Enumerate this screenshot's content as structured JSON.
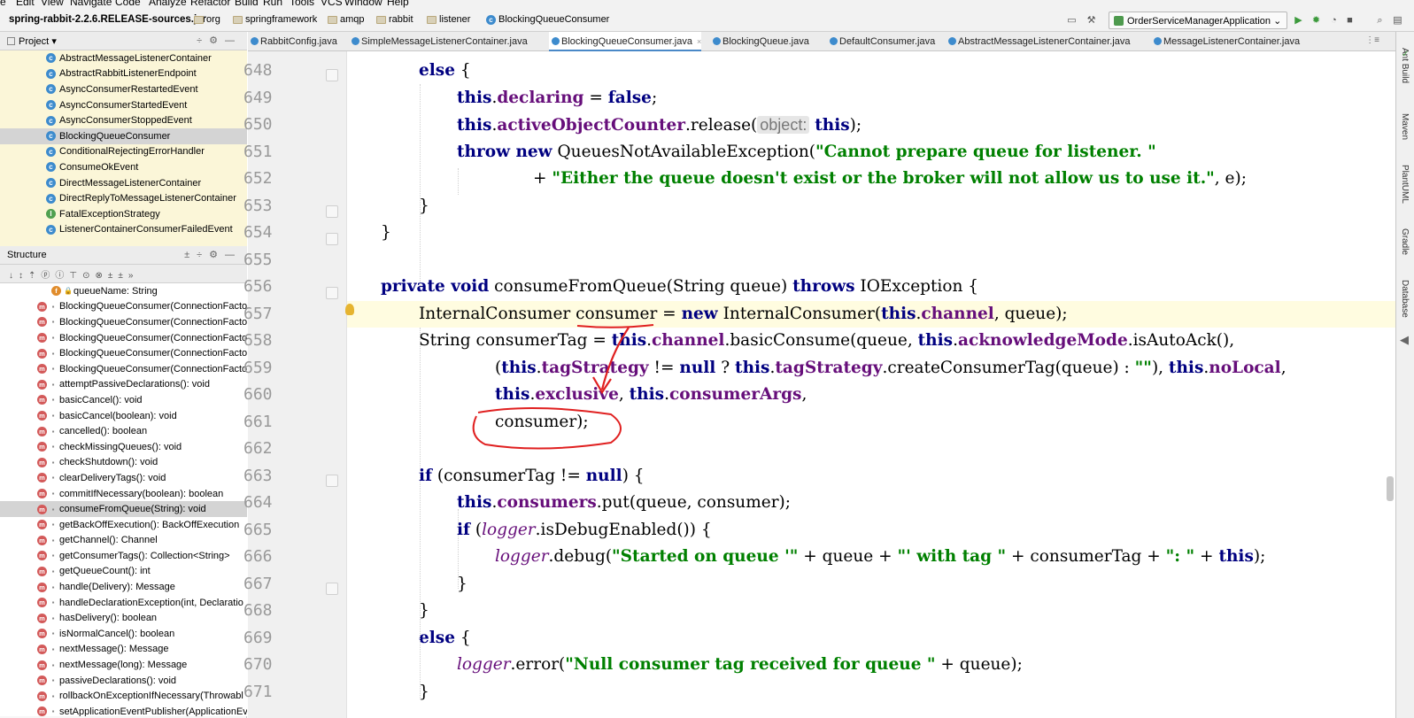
{
  "menu": [
    "e",
    "Edit",
    "View",
    "Navigate",
    "Code",
    "Analyze",
    "Refactor",
    "Build",
    "Run",
    "Tools",
    "VCS",
    "Window",
    "Help"
  ],
  "breadcrumbs": [
    "spring-rabbit-2.2.6.RELEASE-sources.jar",
    "org",
    "springframework",
    "amqp",
    "rabbit",
    "listener",
    "BlockingQueueConsumer"
  ],
  "run_config": "OrderServiceManagerApplication",
  "project_panel": {
    "title": "Project",
    "items": [
      "AbstractMessageListenerContainer",
      "AbstractRabbitListenerEndpoint",
      "AsyncConsumerRestartedEvent",
      "AsyncConsumerStartedEvent",
      "AsyncConsumerStoppedEvent",
      "BlockingQueueConsumer",
      "ConditionalRejectingErrorHandler",
      "ConsumeOkEvent",
      "DirectMessageListenerContainer",
      "DirectReplyToMessageListenerContainer",
      "FatalExceptionStrategy",
      "ListenerContainerConsumerFailedEvent"
    ],
    "selected_index": 5
  },
  "structure_panel": {
    "title": "Structure",
    "field": "queueName: String",
    "items": [
      "BlockingQueueConsumer(ConnectionFacto",
      "BlockingQueueConsumer(ConnectionFacto",
      "BlockingQueueConsumer(ConnectionFacto",
      "BlockingQueueConsumer(ConnectionFacto",
      "BlockingQueueConsumer(ConnectionFacto",
      "attemptPassiveDeclarations(): void",
      "basicCancel(): void",
      "basicCancel(boolean): void",
      "cancelled(): boolean",
      "checkMissingQueues(): void",
      "checkShutdown(): void",
      "clearDeliveryTags(): void",
      "commitIfNecessary(boolean): boolean",
      "consumeFromQueue(String): void",
      "getBackOffExecution(): BackOffExecution",
      "getChannel(): Channel",
      "getConsumerTags(): Collection<String>",
      "getQueueCount(): int",
      "handle(Delivery): Message",
      "handleDeclarationException(int, Declaratio",
      "hasDelivery(): boolean",
      "isNormalCancel(): boolean",
      "nextMessage(): Message",
      "nextMessage(long): Message",
      "passiveDeclarations(): void",
      "rollbackOnExceptionIfNecessary(Throwabl",
      "setApplicationEventPublisher(ApplicationEv"
    ],
    "selected_index": 13
  },
  "tabs": [
    {
      "label": "RabbitConfig.java"
    },
    {
      "label": "SimpleMessageListenerContainer.java"
    },
    {
      "label": "BlockingQueueConsumer.java",
      "active": true
    },
    {
      "label": "BlockingQueue.java"
    },
    {
      "label": "DefaultConsumer.java"
    },
    {
      "label": "AbstractMessageListenerContainer.java"
    },
    {
      "label": "MessageListenerContainer.java"
    }
  ],
  "right_tools": [
    "Ant Build",
    "Maven",
    "PlantUML",
    "Gradle",
    "Database"
  ],
  "editor": {
    "current_line": 657,
    "lines": [
      {
        "n": 648,
        "indent": 1,
        "tokens": [
          [
            "kw",
            "else"
          ],
          [
            "p",
            " {"
          ]
        ]
      },
      {
        "n": 649,
        "indent": 2,
        "tokens": [
          [
            "kw",
            "this"
          ],
          [
            "p",
            "."
          ],
          [
            "fld",
            "declaring"
          ],
          [
            "p",
            " = "
          ],
          [
            "kw",
            "false"
          ],
          [
            "p",
            ";"
          ]
        ]
      },
      {
        "n": 650,
        "indent": 2,
        "tokens": [
          [
            "kw",
            "this"
          ],
          [
            "p",
            "."
          ],
          [
            "fld",
            "activeObjectCounter"
          ],
          [
            "p",
            ".release("
          ],
          [
            "hint",
            "object:"
          ],
          [
            "p",
            " "
          ],
          [
            "kw",
            "this"
          ],
          [
            "p",
            ");"
          ]
        ]
      },
      {
        "n": 651,
        "indent": 2,
        "tokens": [
          [
            "kw",
            "throw new"
          ],
          [
            "p",
            " QueuesNotAvailableException("
          ],
          [
            "str",
            "\"Cannot prepare queue for listener. \""
          ]
        ]
      },
      {
        "n": 652,
        "indent": 4,
        "tokens": [
          [
            "p",
            "+ "
          ],
          [
            "str",
            "\"Either the queue doesn't exist or the broker will not allow us to use it.\""
          ],
          [
            "p",
            ", e);"
          ]
        ]
      },
      {
        "n": 653,
        "indent": 1,
        "tokens": [
          [
            "p",
            "}"
          ]
        ]
      },
      {
        "n": 654,
        "indent": 0,
        "tokens": [
          [
            "p",
            "}"
          ]
        ]
      },
      {
        "n": 655,
        "indent": 0,
        "tokens": []
      },
      {
        "n": 656,
        "indent": 0,
        "tokens": [
          [
            "kw",
            "private void"
          ],
          [
            "p",
            " consumeFromQueue(String queue) "
          ],
          [
            "kw",
            "throws"
          ],
          [
            "p",
            " IOException {"
          ]
        ]
      },
      {
        "n": 657,
        "indent": 1,
        "tokens": [
          [
            "p",
            "InternalConsumer consumer = "
          ],
          [
            "kw",
            "new"
          ],
          [
            "p",
            " InternalConsumer("
          ],
          [
            "kw",
            "this"
          ],
          [
            "p",
            "."
          ],
          [
            "fld",
            "channel"
          ],
          [
            "p",
            ", queue);"
          ]
        ]
      },
      {
        "n": 658,
        "indent": 1,
        "tokens": [
          [
            "p",
            "String consumerTag = "
          ],
          [
            "kw",
            "this"
          ],
          [
            "p",
            "."
          ],
          [
            "fld",
            "channel"
          ],
          [
            "p",
            ".basicConsume(queue, "
          ],
          [
            "kw",
            "this"
          ],
          [
            "p",
            "."
          ],
          [
            "fld",
            "acknowledgeMode"
          ],
          [
            "p",
            ".isAutoAck(),"
          ]
        ]
      },
      {
        "n": 659,
        "indent": 3,
        "tokens": [
          [
            "p",
            "("
          ],
          [
            "kw",
            "this"
          ],
          [
            "p",
            "."
          ],
          [
            "fld",
            "tagStrategy"
          ],
          [
            "p",
            " != "
          ],
          [
            "kw",
            "null"
          ],
          [
            "p",
            " ? "
          ],
          [
            "kw",
            "this"
          ],
          [
            "p",
            "."
          ],
          [
            "fld",
            "tagStrategy"
          ],
          [
            "p",
            ".createConsumerTag(queue) : "
          ],
          [
            "str",
            "\"\""
          ],
          [
            "p",
            "), "
          ],
          [
            "kw",
            "this"
          ],
          [
            "p",
            "."
          ],
          [
            "fld",
            "noLocal"
          ],
          [
            "p",
            ","
          ]
        ]
      },
      {
        "n": 660,
        "indent": 3,
        "tokens": [
          [
            "kw",
            "this"
          ],
          [
            "p",
            "."
          ],
          [
            "fld",
            "exclusive"
          ],
          [
            "p",
            ", "
          ],
          [
            "kw",
            "this"
          ],
          [
            "p",
            "."
          ],
          [
            "fld",
            "consumerArgs"
          ],
          [
            "p",
            ","
          ]
        ]
      },
      {
        "n": 661,
        "indent": 3,
        "tokens": [
          [
            "p",
            "consumer);"
          ]
        ]
      },
      {
        "n": 662,
        "indent": 0,
        "tokens": []
      },
      {
        "n": 663,
        "indent": 1,
        "tokens": [
          [
            "kw",
            "if"
          ],
          [
            "p",
            " (consumerTag != "
          ],
          [
            "kw",
            "null"
          ],
          [
            "p",
            ") {"
          ]
        ]
      },
      {
        "n": 664,
        "indent": 2,
        "tokens": [
          [
            "kw",
            "this"
          ],
          [
            "p",
            "."
          ],
          [
            "fld",
            "consumers"
          ],
          [
            "p",
            ".put(queue, consumer);"
          ]
        ]
      },
      {
        "n": 665,
        "indent": 2,
        "tokens": [
          [
            "kw",
            "if"
          ],
          [
            "p",
            " ("
          ],
          [
            "it",
            "logger"
          ],
          [
            "p",
            ".isDebugEnabled()) {"
          ]
        ]
      },
      {
        "n": 666,
        "indent": 3,
        "tokens": [
          [
            "it",
            "logger"
          ],
          [
            "p",
            ".debug("
          ],
          [
            "str",
            "\"Started on queue '\""
          ],
          [
            "p",
            " + queue + "
          ],
          [
            "str",
            "\"' with tag \""
          ],
          [
            "p",
            " + consumerTag + "
          ],
          [
            "str",
            "\": \""
          ],
          [
            "p",
            " + "
          ],
          [
            "kw",
            "this"
          ],
          [
            "p",
            ");"
          ]
        ]
      },
      {
        "n": 667,
        "indent": 2,
        "tokens": [
          [
            "p",
            "}"
          ]
        ]
      },
      {
        "n": 668,
        "indent": 1,
        "tokens": [
          [
            "p",
            "}"
          ]
        ]
      },
      {
        "n": 669,
        "indent": 1,
        "tokens": [
          [
            "kw",
            "else"
          ],
          [
            "p",
            " {"
          ]
        ]
      },
      {
        "n": 670,
        "indent": 2,
        "tokens": [
          [
            "it",
            "logger"
          ],
          [
            "p",
            ".error("
          ],
          [
            "str",
            "\"Null consumer tag received for queue \""
          ],
          [
            "p",
            " + queue);"
          ]
        ]
      },
      {
        "n": 671,
        "indent": 1,
        "tokens": [
          [
            "p",
            "}"
          ]
        ]
      }
    ]
  },
  "annotation_color": "#e02020"
}
